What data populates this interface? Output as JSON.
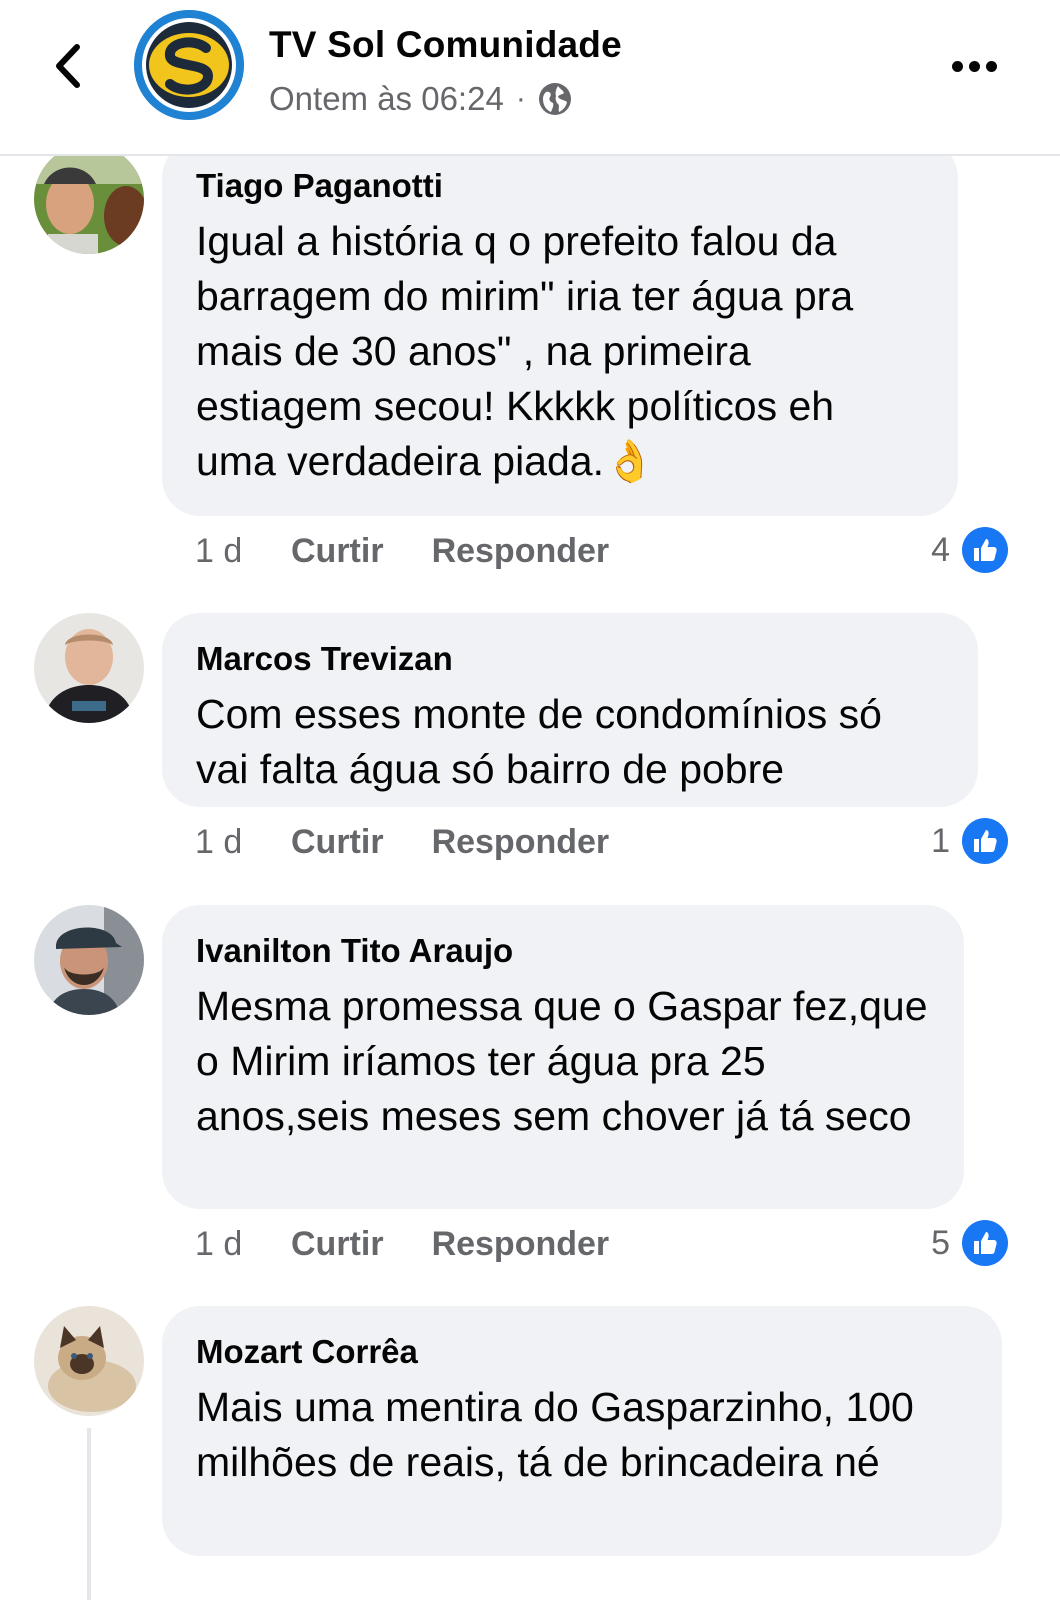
{
  "colors": {
    "accent": "#1877f2",
    "bubble": "#f0f2f5",
    "secondary_text": "#65676b"
  },
  "header": {
    "back_icon": "chevron-left-icon",
    "page_name": "TV Sol Comunidade",
    "timestamp": "Ontem às 06:24",
    "separator": "·",
    "privacy_icon": "globe-icon",
    "more_icon": "more-horizontal-icon"
  },
  "comments": [
    {
      "author": "Tiago Paganotti",
      "text": "Igual a história q o prefeito falou da barragem do mirim\" iria ter água pra mais de 30 anos\" , na primeira estiagem secou! Kkkkk políticos eh uma verdadeira piada.",
      "emoji": "👌",
      "time": "1 d",
      "like_label": "Curtir",
      "reply_label": "Responder",
      "reaction_count": "4",
      "reaction_icon": "thumbs-up-icon"
    },
    {
      "author": "Marcos Trevizan",
      "text": "Com esses monte de condomínios só vai falta água só bairro de pobre",
      "time": "1 d",
      "like_label": "Curtir",
      "reply_label": "Responder",
      "reaction_count": "1",
      "reaction_icon": "thumbs-up-icon"
    },
    {
      "author": "Ivanilton Tito Araujo",
      "text": "Mesma promessa que o Gaspar fez,que o Mirim iríamos ter água pra 25 anos,seis meses sem chover já tá seco",
      "time": "1 d",
      "like_label": "Curtir",
      "reply_label": "Responder",
      "reaction_count": "5",
      "reaction_icon": "thumbs-up-icon"
    },
    {
      "author": "Mozart Corrêa",
      "text": "Mais uma mentira do Gasparzinho, 100 milhões de reais, tá de brincadeira né"
    }
  ]
}
